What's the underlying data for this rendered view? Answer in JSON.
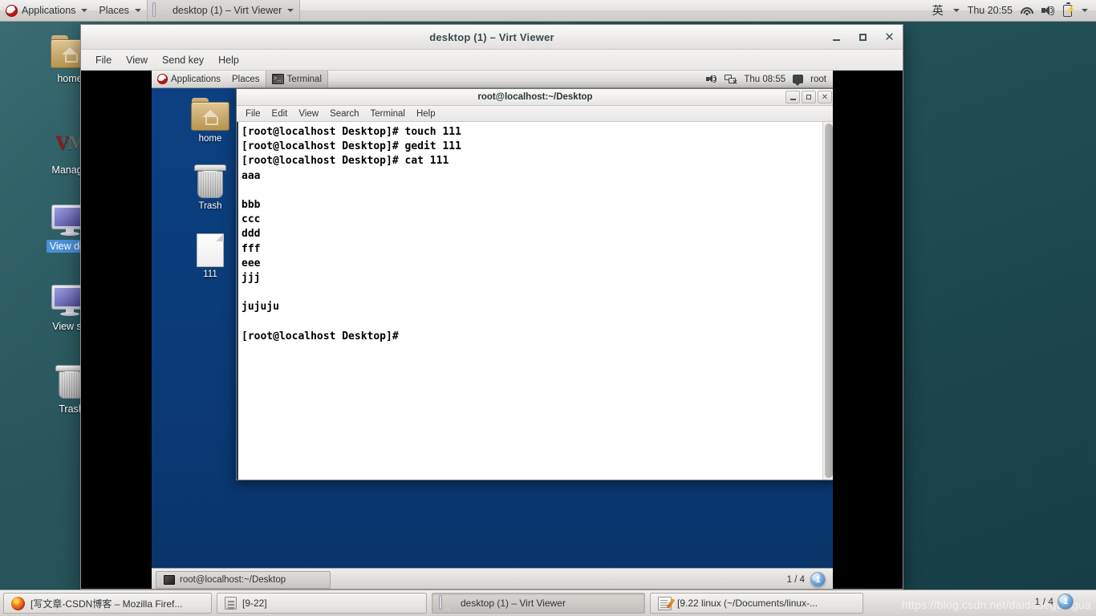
{
  "host": {
    "top_panel": {
      "applications_label": "Applications",
      "places_label": "Places",
      "window_button_label": "desktop (1) – Virt Viewer",
      "ime_label": "英",
      "clock": "Thu 20:55",
      "icons": [
        "fedora-logo",
        "wifi-icon",
        "volume-icon",
        "battery-icon",
        "chevron-down-icon"
      ]
    },
    "desktop_icons": [
      {
        "label": "home",
        "icon": "home-folder-icon",
        "selected": false
      },
      {
        "label": "Manage",
        "icon": "vmware-icon",
        "selected": false
      },
      {
        "label": "View des",
        "icon": "monitor-icon",
        "selected": true
      },
      {
        "label": "View se",
        "icon": "monitor-icon",
        "selected": false
      },
      {
        "label": "Trash",
        "icon": "trash-icon",
        "selected": false
      }
    ],
    "taskbar": {
      "buttons": [
        {
          "label": "[写文章-CSDN博客 – Mozilla Firef...",
          "icon": "firefox-icon",
          "active": false
        },
        {
          "label": "[9-22]",
          "icon": "archive-icon",
          "active": false
        },
        {
          "label": "desktop (1) – Virt Viewer",
          "icon": "virt-viewer-icon",
          "active": true
        },
        {
          "label": "[9.22 linux (~/Documents/linux-...",
          "icon": "gedit-icon",
          "active": false
        }
      ],
      "workspace_indicator": "1 / 4"
    },
    "watermark": "https://blog.csdn.net/daidadeguaigua"
  },
  "virt_viewer": {
    "title": "desktop (1) – Virt Viewer",
    "menu": [
      "File",
      "View",
      "Send key",
      "Help"
    ],
    "window_controls": [
      "minimize-icon",
      "maximize-icon",
      "close-icon"
    ]
  },
  "guest": {
    "top_panel": {
      "applications_label": "Applications",
      "places_label": "Places",
      "window_button_label": "Terminal",
      "clock": "Thu 08:55",
      "user_label": "root"
    },
    "desktop_icons": [
      {
        "label": "home",
        "icon": "home-folder-icon"
      },
      {
        "label": "Trash",
        "icon": "trash-icon"
      },
      {
        "label": "111",
        "icon": "text-file-icon"
      }
    ],
    "taskbar": {
      "task_label": "root@localhost:~/Desktop",
      "workspace_indicator": "1 / 4",
      "workspace_badge": "1"
    },
    "terminal": {
      "title": "root@localhost:~/Desktop",
      "menu": [
        "File",
        "Edit",
        "View",
        "Search",
        "Terminal",
        "Help"
      ],
      "window_controls": [
        "minimize-icon",
        "maximize-icon",
        "close-icon"
      ],
      "output": "[root@localhost Desktop]# touch 111\n[root@localhost Desktop]# gedit 111\n[root@localhost Desktop]# cat 111\naaa\n\nbbb\nccc\nddd\nfff\neee\njjj\n\njujuju\n\n[root@localhost Desktop]# "
    }
  },
  "colors": {
    "host_desktop": "#24555c",
    "guest_desktop": "#0a3d7c",
    "selection_blue": "#4a90d9",
    "terminal_bg": "#ffffff",
    "terminal_fg": "#000000"
  }
}
